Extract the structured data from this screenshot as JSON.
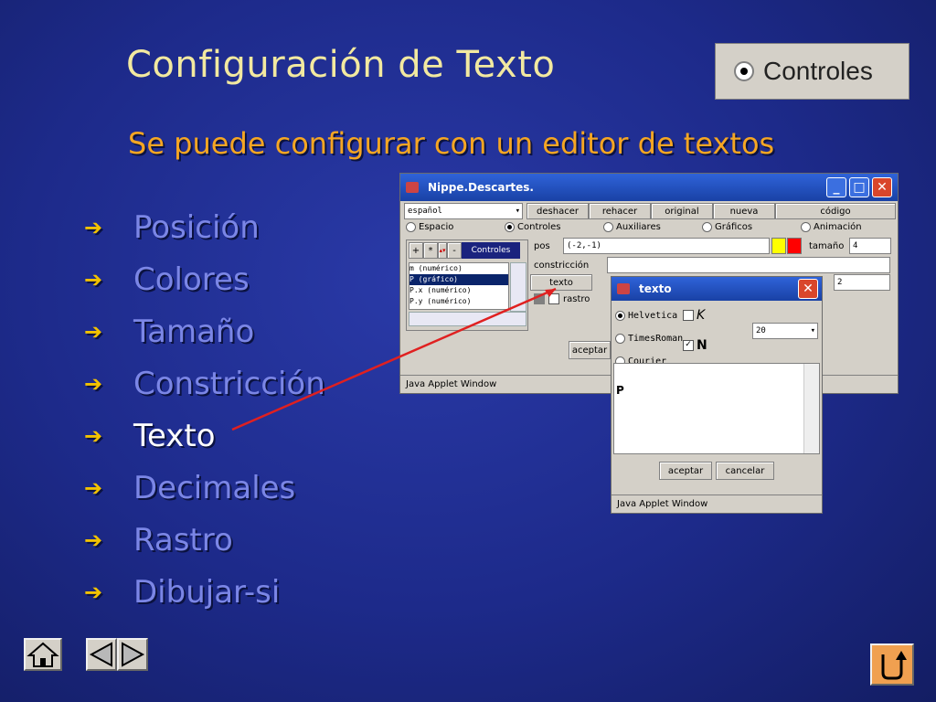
{
  "slide": {
    "title": "Configuración de Texto",
    "subtitle": "Se puede configurar con un editor de textos",
    "badge_label": "Controles",
    "bullets": [
      {
        "label": "Posición",
        "active": false
      },
      {
        "label": "Colores",
        "active": false
      },
      {
        "label": "Tamaño",
        "active": false
      },
      {
        "label": "Constricción",
        "active": false
      },
      {
        "label": "Texto",
        "active": true
      },
      {
        "label": "Decimales",
        "active": false
      },
      {
        "label": "Rastro",
        "active": false
      },
      {
        "label": "Dibujar-si",
        "active": false
      }
    ],
    "bullet_arrow": "➔"
  },
  "main_window": {
    "title": "Nippe.Descartes.",
    "language": "español",
    "toolbar": [
      "deshacer",
      "rehacer",
      "original",
      "nueva",
      "código"
    ],
    "tabs": [
      {
        "label": "Espacio",
        "selected": false
      },
      {
        "label": "Controles",
        "selected": true
      },
      {
        "label": "Auxiliares",
        "selected": false
      },
      {
        "label": "Gráficos",
        "selected": false
      },
      {
        "label": "Animación",
        "selected": false
      }
    ],
    "list_buttons": [
      "+",
      "*",
      "-"
    ],
    "list_header": "Controles",
    "list_items": [
      "m (numérico)",
      "P (gráfico)",
      "P.x (numérico)",
      "P.y (numérico)"
    ],
    "pos_label": "pos",
    "pos_value": "(-2,-1)",
    "colors": [
      "#ffff00",
      "#ff0000"
    ],
    "size_label": "tamaño",
    "size_value": "4",
    "constraint_label": "constricción",
    "text_button": "texto",
    "decimals_value": "2",
    "trace_label": "rastro",
    "accept_button": "aceptar",
    "status": "Java Applet Window"
  },
  "text_window": {
    "title": "texto",
    "fonts": [
      {
        "label": "Helvetica",
        "selected": true
      },
      {
        "label": "TimesRoman",
        "selected": false
      },
      {
        "label": "Courier",
        "selected": false
      }
    ],
    "italic_label": "K",
    "italic_checked": false,
    "bold_label": "N",
    "bold_checked": true,
    "size_value": "20",
    "text_content": "P",
    "accept_button": "aceptar",
    "cancel_button": "cancelar",
    "status": "Java Applet Window"
  },
  "nav": {
    "home_icon": "home-icon",
    "prev_icon": "prev-arrow-icon",
    "next_icon": "next-arrow-icon",
    "return_icon": "return-icon"
  }
}
